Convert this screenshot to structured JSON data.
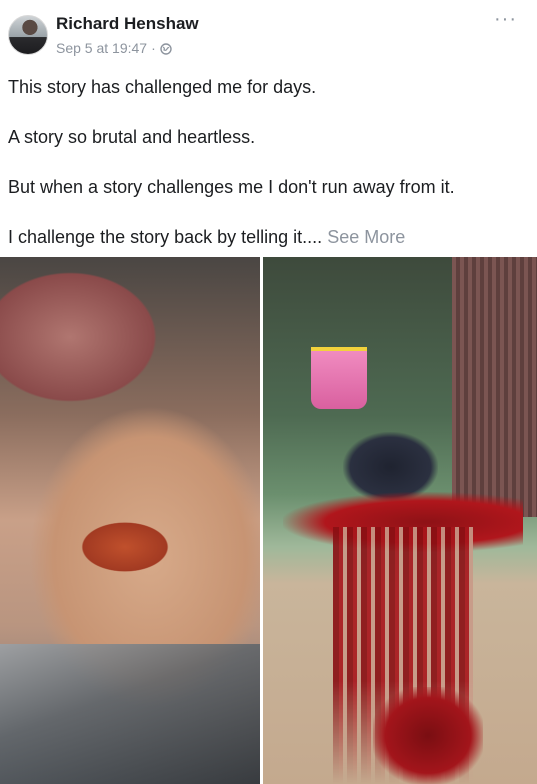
{
  "post": {
    "author": "Richard Henshaw",
    "timestamp": "Sep 5 at 19:47",
    "separator": "·",
    "privacy_icon": "globe-icon",
    "menu_icon": "more-options-icon",
    "menu_glyph": "···",
    "paragraphs": [
      "This story has challenged me for days.",
      "A story so brutal and heartless.",
      "But when a story challenges me I don't run away from it.",
      "I challenge the story back by telling it...."
    ],
    "see_more": "See More"
  },
  "photos": [
    {
      "name": "photo-left",
      "description_icon": "photo-icon"
    },
    {
      "name": "photo-right",
      "description_icon": "photo-icon"
    }
  ]
}
